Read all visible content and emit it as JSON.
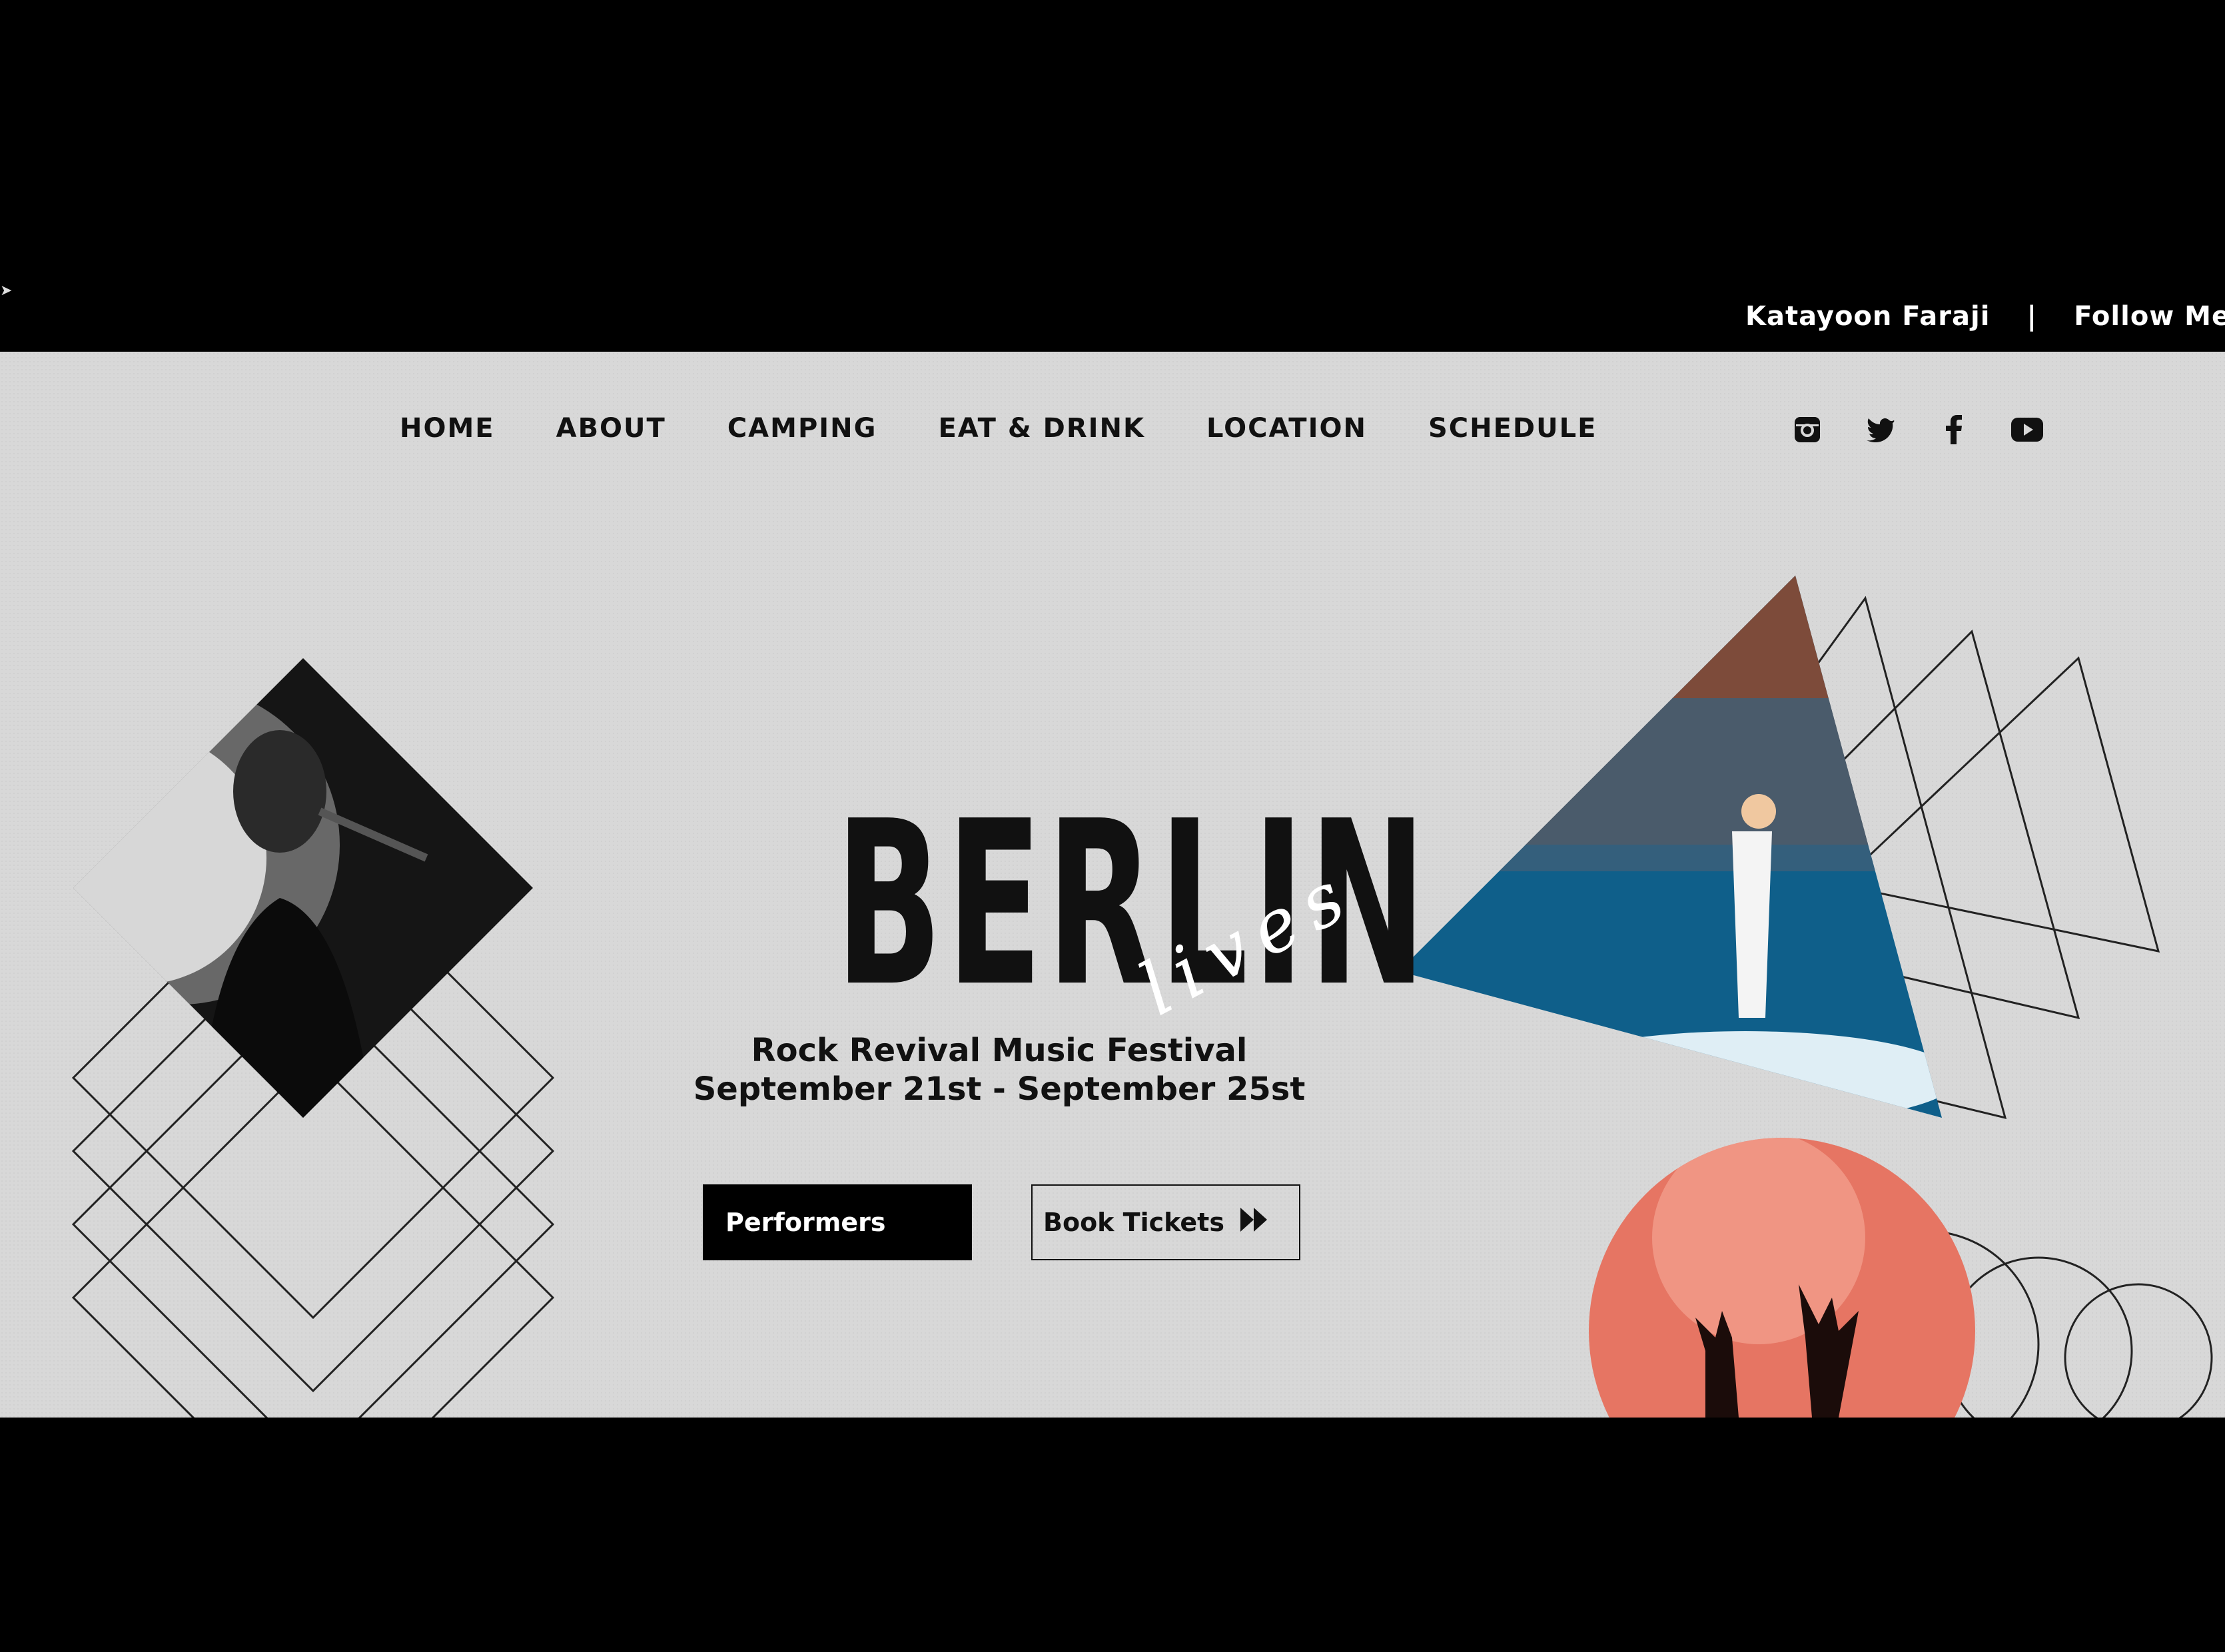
{
  "credit": {
    "author": "Katayoon Faraji",
    "separator": "|",
    "follow": "Follow Me"
  },
  "nav": {
    "items": [
      {
        "label": "HOME"
      },
      {
        "label": "ABOUT"
      },
      {
        "label": "CAMPING"
      },
      {
        "label": "EAT & DRINK"
      },
      {
        "label": "LOCATION"
      },
      {
        "label": "SCHEDULE"
      }
    ]
  },
  "socials": [
    "instagram-icon",
    "twitter-icon",
    "facebook-icon",
    "youtube-icon"
  ],
  "hero": {
    "title": "BERLIN",
    "script": "lives",
    "subtitle_line1": "Rock Revival Music Festival",
    "subtitle_line2": "September 21st - September 25st"
  },
  "buttons": {
    "performers": "Performers",
    "tickets": "Book Tickets"
  },
  "colors": {
    "background": "#d8d8d8",
    "dark": "#000000",
    "accent_blue": "#1d7fb0",
    "accent_red": "#e06a5a"
  }
}
